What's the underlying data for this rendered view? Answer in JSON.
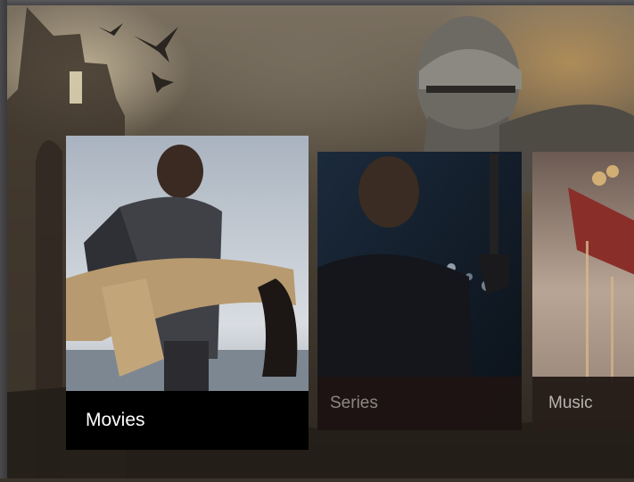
{
  "menu": {
    "items": [
      {
        "id": "movies",
        "label": "Movies",
        "selected": true
      },
      {
        "id": "series",
        "label": "Series",
        "selected": false
      },
      {
        "id": "music",
        "label": "Music",
        "selected": false
      }
    ]
  },
  "colors": {
    "label_bar": "#000000",
    "label_text": "#ffffff",
    "dim_label_text": "#8c8680"
  }
}
